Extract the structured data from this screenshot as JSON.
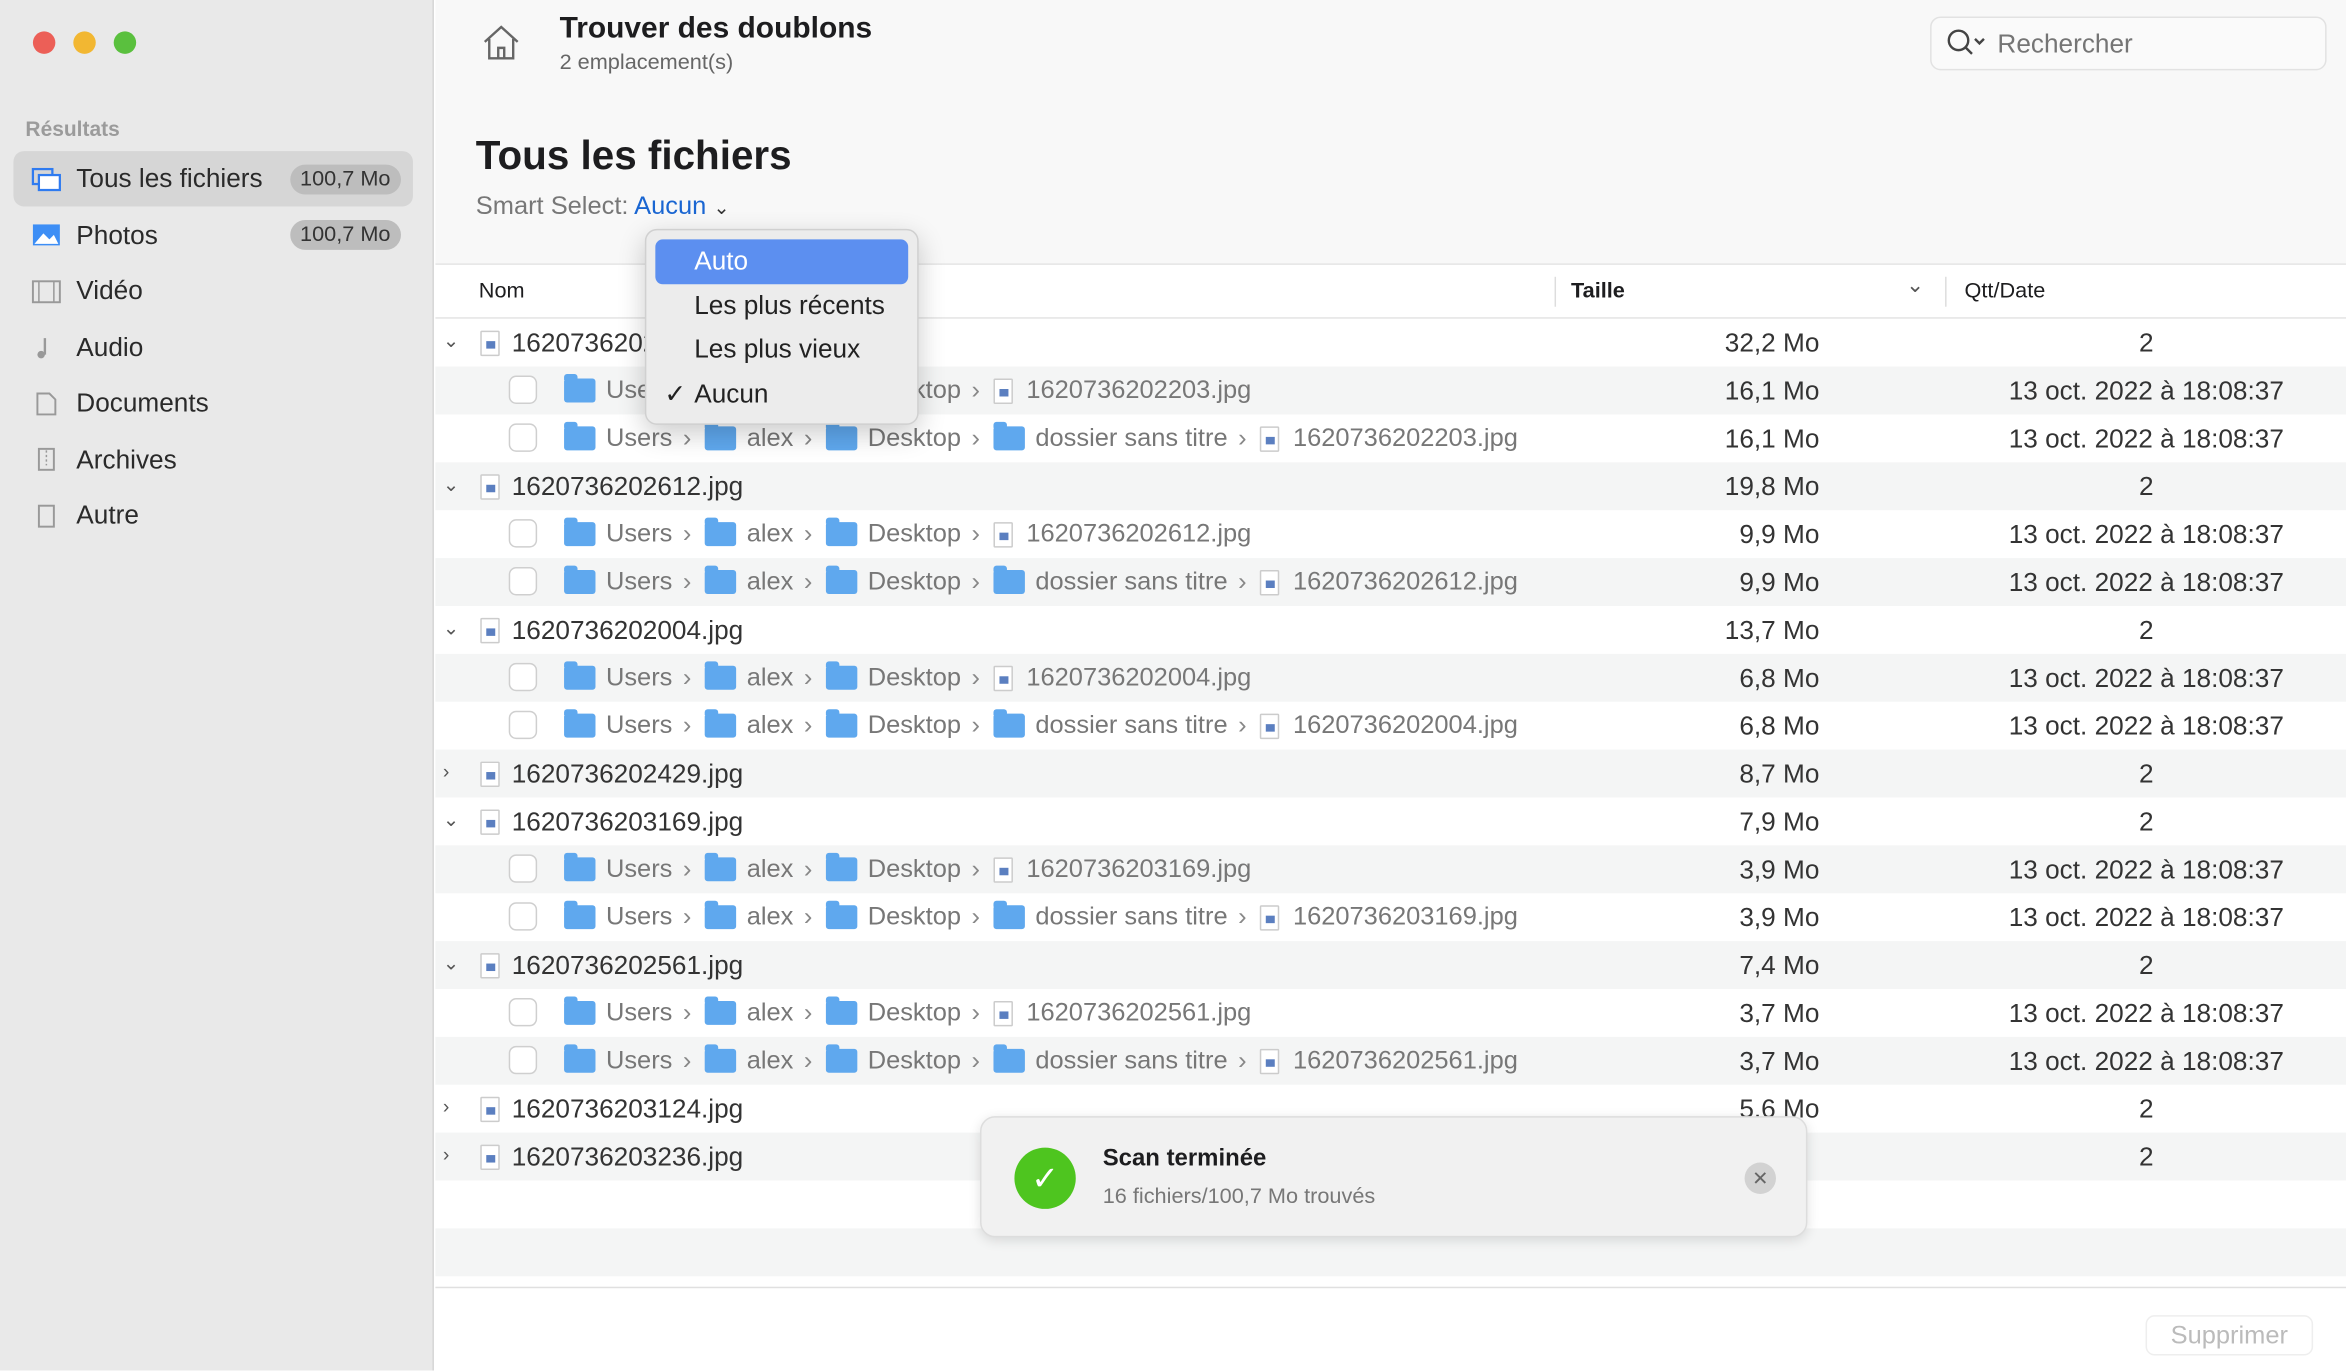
{
  "window": {
    "controls": {
      "close": "#ec5f57",
      "minimize": "#f2b732",
      "maximize": "#5ac03e"
    }
  },
  "sidebar": {
    "section": "Résultats",
    "items": [
      {
        "label": "Tous les fichiers",
        "badge": "100,7 Mo",
        "icon": "stack-icon",
        "selected": true
      },
      {
        "label": "Photos",
        "badge": "100,7 Mo",
        "icon": "photo-icon"
      },
      {
        "label": "Vidéo",
        "icon": "film-icon"
      },
      {
        "label": "Audio",
        "icon": "music-note-icon"
      },
      {
        "label": "Documents",
        "icon": "document-icon"
      },
      {
        "label": "Archives",
        "icon": "archive-icon"
      },
      {
        "label": "Autre",
        "icon": "other-file-icon"
      }
    ]
  },
  "header": {
    "title": "Trouver des doublons",
    "subtitle": "2 emplacement(s)",
    "search_placeholder": "Rechercher"
  },
  "main": {
    "title": "Tous les fichiers",
    "smart_select_label": "Smart Select:",
    "smart_select_value": "Aucun",
    "menu": {
      "items": [
        "Auto",
        "Les plus récents",
        "Les plus vieux",
        "Aucun"
      ],
      "highlighted": "Auto",
      "checked": "Aucun"
    },
    "columns": {
      "name": "Nom",
      "size": "Taille",
      "qty_date": "Qtt/Date"
    },
    "path_parts": [
      "Users",
      "alex",
      "Desktop"
    ],
    "subfolder": "dossier sans titre",
    "date": "13 oct. 2022 à 18:08:37",
    "groups": [
      {
        "name": "1620736202203.jpg",
        "size": "32,2 Mo",
        "count": "2",
        "expanded": true,
        "child_size": "16,1 Mo"
      },
      {
        "name": "1620736202612.jpg",
        "size": "19,8 Mo",
        "count": "2",
        "expanded": true,
        "child_size": "9,9 Mo"
      },
      {
        "name": "1620736202004.jpg",
        "size": "13,7 Mo",
        "count": "2",
        "expanded": true,
        "child_size": "6,8 Mo"
      },
      {
        "name": "1620736202429.jpg",
        "size": "8,7 Mo",
        "count": "2",
        "expanded": false
      },
      {
        "name": "1620736203169.jpg",
        "size": "7,9 Mo",
        "count": "2",
        "expanded": true,
        "child_size": "3,9 Mo"
      },
      {
        "name": "1620736202561.jpg",
        "size": "7,4 Mo",
        "count": "2",
        "expanded": true,
        "child_size": "3,7 Mo"
      },
      {
        "name": "1620736203124.jpg",
        "size": "5,6 Mo",
        "count": "2",
        "expanded": false
      },
      {
        "name": "1620736203236.jpg",
        "size": "",
        "count": "2",
        "expanded": false
      }
    ]
  },
  "toast": {
    "title": "Scan terminée",
    "message": "16 fichiers/100,7 Mo trouvés",
    "color": "#4ec51f"
  },
  "footer": {
    "delete_label": "Supprimer"
  }
}
